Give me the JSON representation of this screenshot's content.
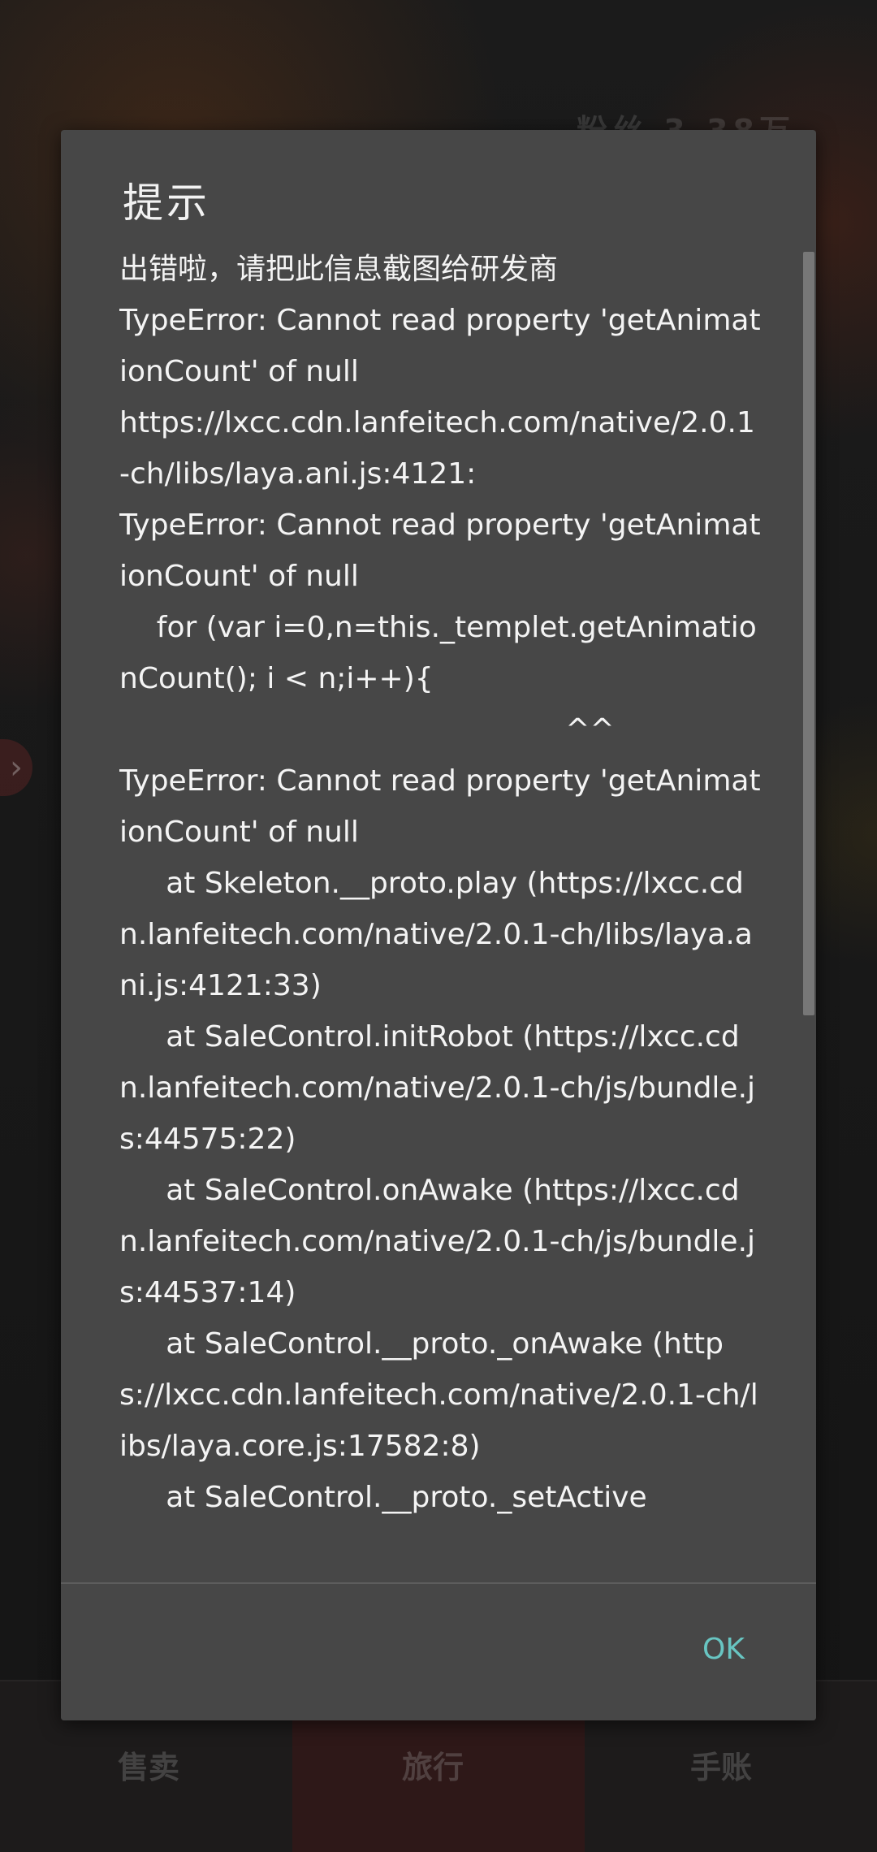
{
  "background": {
    "top_text": "粉丝 3.38万",
    "nav_items": [
      "售卖",
      "旅行",
      "手账"
    ]
  },
  "dialog": {
    "title": "提示",
    "message": "出错啦，请把此信息截图给研发商\nTypeError: Cannot read property 'getAnimationCount' of null\nhttps://lxcc.cdn.lanfeitech.com/native/2.0.1-ch/libs/laya.ani.js:4121:\nTypeError: Cannot read property 'getAnimationCount' of null\n    for (var i=0,n=this._templet.getAnimationCount(); i < n;i++){\n                                                ^^\nTypeError: Cannot read property 'getAnimationCount' of null\n     at Skeleton.__proto.play (https://lxcc.cdn.lanfeitech.com/native/2.0.1-ch/libs/laya.ani.js:4121:33)\n     at SaleControl.initRobot (https://lxcc.cdn.lanfeitech.com/native/2.0.1-ch/js/bundle.js:44575:22)\n     at SaleControl.onAwake (https://lxcc.cdn.lanfeitech.com/native/2.0.1-ch/js/bundle.js:44537:14)\n     at SaleControl.__proto._onAwake (https://lxcc.cdn.lanfeitech.com/native/2.0.1-ch/libs/laya.core.js:17582:8)\n     at SaleControl.__proto._setActive",
    "ok_label": "OK"
  },
  "colors": {
    "dialog_bg": "#474747",
    "accent": "#68c5c2",
    "text": "#f4f4f4"
  }
}
